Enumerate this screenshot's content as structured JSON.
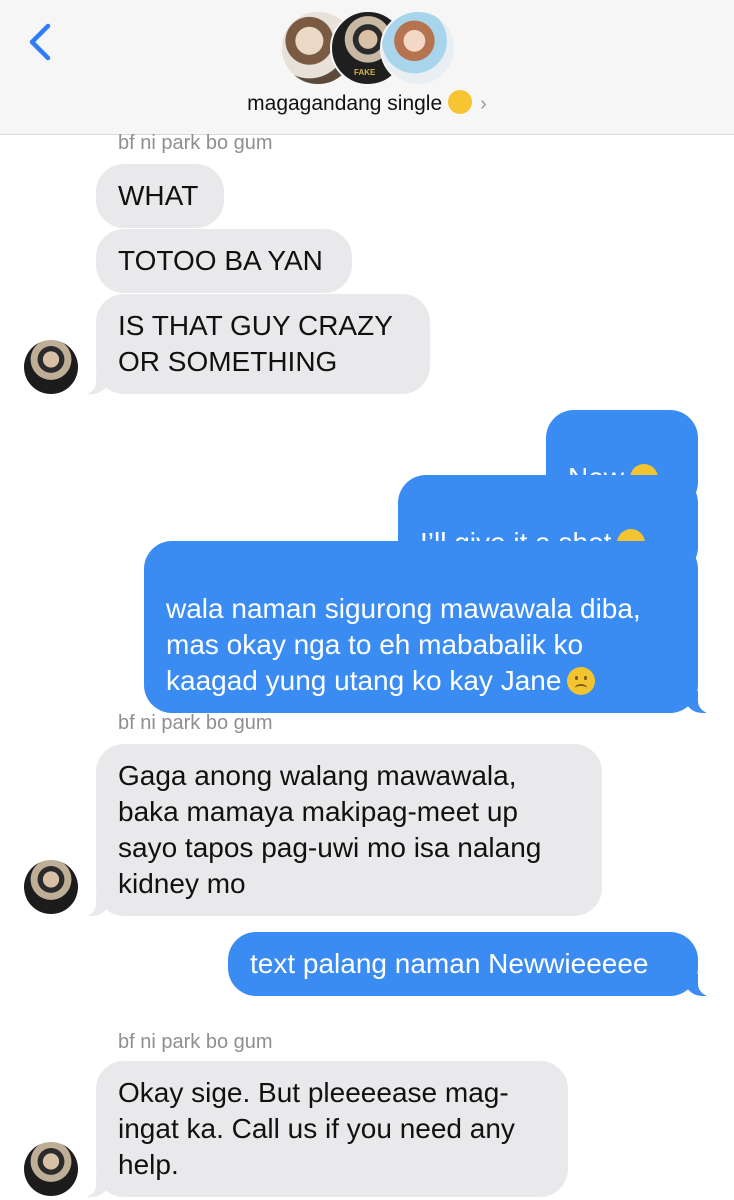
{
  "header": {
    "back_icon": "chevron-left-icon",
    "group_name": "magagandang single",
    "group_emoji": "zany-face-emoji",
    "chevron": "›"
  },
  "messages": [
    {
      "type": "sender",
      "text": "bf ni park bo gum"
    },
    {
      "type": "in",
      "text": "WHAT"
    },
    {
      "type": "in",
      "text": "TOTOO BA YAN"
    },
    {
      "type": "in",
      "text": "IS THAT GUY CRAZY\nOR SOMETHING"
    },
    {
      "type": "out",
      "text": "New",
      "emoji": "loudly-crying-face"
    },
    {
      "type": "out",
      "text": "I’ll give it a shot",
      "emoji": "loudly-crying-face"
    },
    {
      "type": "out",
      "text": "wala naman sigurong mawawala diba,\nmas okay nga to eh mababalik ko\nkaagad yung utang ko kay Jane",
      "emoji": "frowning-face"
    },
    {
      "type": "sender",
      "text": "bf ni park bo gum"
    },
    {
      "type": "in",
      "text": "Gaga anong walang mawawala,\nbaka mamaya makipag-meet up\nsayo tapos pag-uwi mo isa nalang\nkidney mo"
    },
    {
      "type": "out",
      "text": "text palang naman Newwieeeee"
    },
    {
      "type": "sender",
      "text": "bf ni park bo gum"
    },
    {
      "type": "in",
      "text": "Okay sige. But pleeeease mag-\ningat ka. Call us if you need any\nhelp."
    }
  ],
  "colors": {
    "outgoing": "#3a8cf2",
    "incoming": "#e9e9eb",
    "sender_label": "#8e8e93",
    "header_bg": "#f6f6f6"
  }
}
